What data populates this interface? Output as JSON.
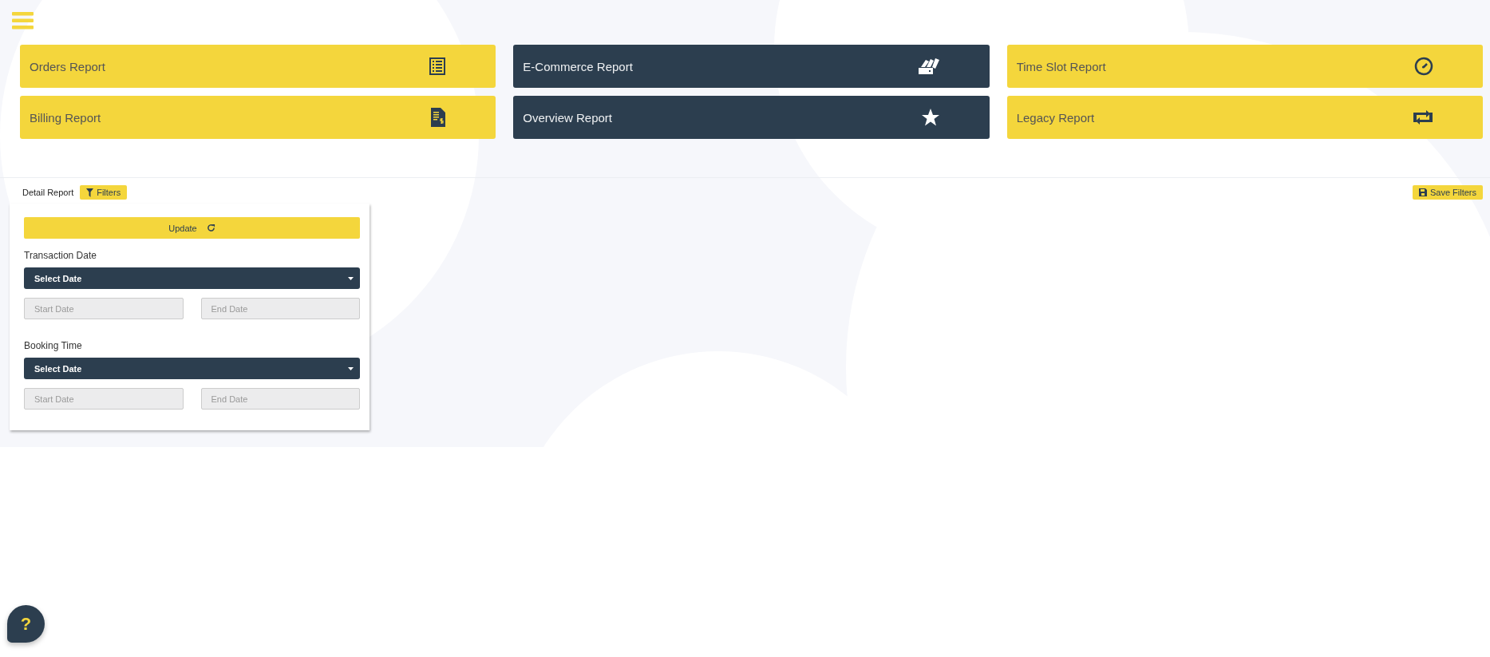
{
  "report_cards": [
    {
      "label": "Orders Report"
    },
    {
      "label": "E-Commerce Report"
    },
    {
      "label": "Time Slot Report"
    },
    {
      "label": "Billing Report"
    },
    {
      "label": "Overview Report"
    },
    {
      "label": "Legacy Report"
    }
  ],
  "detail_report": {
    "title": "Detail Report",
    "filters_button": "Filters",
    "save_filters_button": "Save Filters"
  },
  "filter_panel": {
    "update_button": "Update",
    "groups": [
      {
        "label": "Transaction Date",
        "select": "Select Date",
        "start_placeholder": "Start Date",
        "end_placeholder": "End Date"
      },
      {
        "label": "Booking Time",
        "select": "Select Date",
        "start_placeholder": "Start Date",
        "end_placeholder": "End Date"
      }
    ]
  },
  "help_button": "?"
}
